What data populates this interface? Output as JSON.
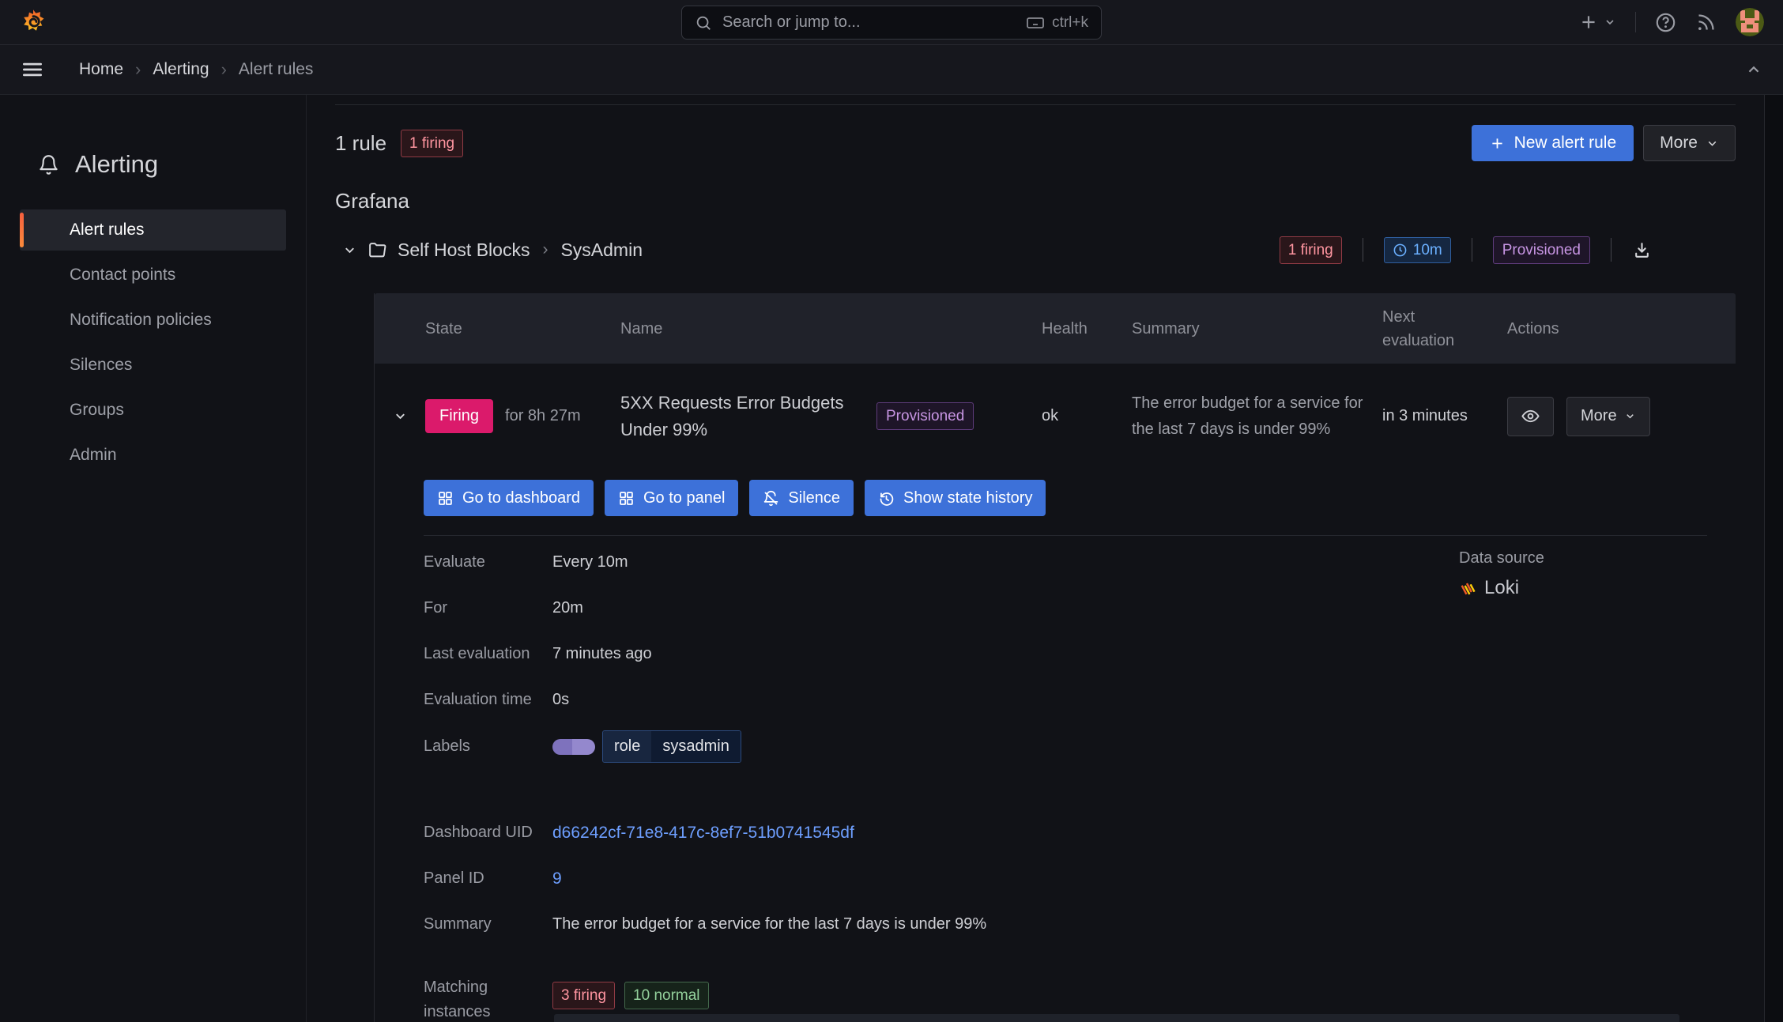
{
  "topbar": {
    "search_placeholder": "Search or jump to...",
    "shortcut": "ctrl+k"
  },
  "breadcrumb": {
    "items": [
      "Home",
      "Alerting",
      "Alert rules"
    ]
  },
  "sidebar": {
    "title": "Alerting",
    "items": [
      {
        "label": "Alert rules",
        "active": true
      },
      {
        "label": "Contact points",
        "active": false
      },
      {
        "label": "Notification policies",
        "active": false
      },
      {
        "label": "Silences",
        "active": false
      },
      {
        "label": "Groups",
        "active": false
      },
      {
        "label": "Admin",
        "active": false
      }
    ]
  },
  "main": {
    "rules_count": "1 rule",
    "rules_firing_badge": "1 firing",
    "new_alert_rule_label": "New alert rule",
    "more_label": "More",
    "group_heading": "Grafana",
    "folder": {
      "name": "Self Host Blocks",
      "separator": "›",
      "subfolder": "SysAdmin",
      "firing_badge": "1 firing",
      "interval_badge": "10m",
      "provisioned_badge": "Provisioned"
    },
    "table": {
      "headers": [
        "State",
        "Name",
        "Health",
        "Summary",
        "Next evaluation",
        "Actions"
      ],
      "row": {
        "state": "Firing",
        "state_duration": "for 8h 27m",
        "name": "5XX Requests Error Budgets Under 99%",
        "provisioned_badge": "Provisioned",
        "health": "ok",
        "summary": "The error budget for a service for the last 7 days is under 99%",
        "next_evaluation": "in 3 minutes",
        "more_label": "More"
      }
    },
    "row_actions": [
      "Go to dashboard",
      "Go to panel",
      "Silence",
      "Show state history"
    ],
    "details": {
      "evaluate_label": "Evaluate",
      "evaluate": "Every 10m",
      "for_label": "For",
      "for": "20m",
      "last_evaluation_label": "Last evaluation",
      "last_evaluation": "7 minutes ago",
      "evaluation_time_label": "Evaluation time",
      "evaluation_time": "0s",
      "labels_label": "Labels",
      "label_key": "role",
      "label_value": "sysadmin",
      "datasource_label": "Data source",
      "datasource": "Loki",
      "dashboard_uid_label": "Dashboard UID",
      "dashboard_uid": "d66242cf-71e8-417c-8ef7-51b0741545df",
      "panel_id_label": "Panel ID",
      "panel_id": "9",
      "summary_label": "Summary",
      "summary": "The error budget for a service for the last 7 days is under 99%",
      "matching_label": "Matching instances",
      "matching_firing": "3 firing",
      "matching_normal": "10 normal"
    }
  },
  "colors": {
    "background": "#111217",
    "bar_background": "#16171d",
    "primary_blue": "#3d71d9",
    "link_blue": "#6e9fff",
    "firing_pink": "#db1a6b",
    "firing_badge_text": "#ff95a0",
    "interval_badge_text": "#6bb0ff",
    "provisioned_text": "#c795e3",
    "normal_green_text": "#94d19c",
    "active_item_orange": "#f55f3e"
  }
}
